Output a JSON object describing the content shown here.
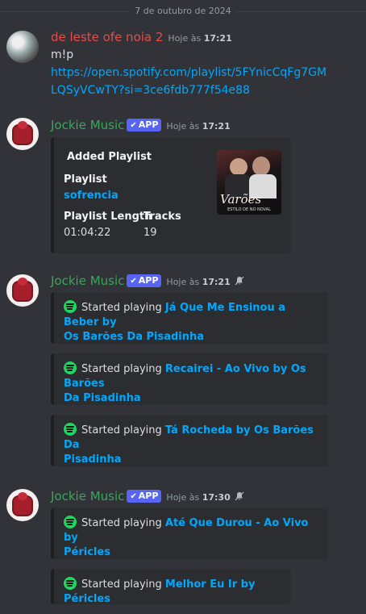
{
  "date_divider": "7 de outubro de 2024",
  "messages": [
    {
      "author": "de leste ofe noia 2",
      "time_prefix": "Hoje às ",
      "time": "17:21",
      "text": "m!p",
      "link_line1": "https://open.spotify.com/playlist/5FYnicCqFg7GM",
      "link_line2": "LQSyVCwTY?si=3ce6fdb777f54e88"
    },
    {
      "author": "Jockie Music",
      "badge": "APP",
      "time_prefix": "Hoje às ",
      "time": "17:21",
      "embed": {
        "title": "Added Playlist",
        "f1_name": "Playlist",
        "f1_value": "sofrencia",
        "f2_name": "Playlist Length",
        "f2_value": "01:04:22",
        "f3_name": "Tracks",
        "f3_value": "19",
        "thumb_script": "Varões",
        "thumb_caption": "ESTILO DE NO NOVAL"
      }
    },
    {
      "author": "Jockie Music",
      "badge": "APP",
      "time_prefix": "Hoje às ",
      "time": "17:21",
      "embeds": [
        {
          "prefix": "Started playing ",
          "song_line1": "Já Que Me Ensinou a Beber by",
          "song_line2": "Os Barões Da Pisadinha"
        },
        {
          "prefix": "Started playing ",
          "song_line1": "Recairei - Ao Vivo by Os Barões",
          "song_line2": "Da Pisadinha"
        },
        {
          "prefix": "Started playing ",
          "song_line1": "Tá Rocheda by Os Barões Da",
          "song_line2": "Pisadinha"
        }
      ]
    },
    {
      "author": "Jockie Music",
      "badge": "APP",
      "time_prefix": "Hoje às ",
      "time": "17:30",
      "embeds": [
        {
          "prefix": "Started playing ",
          "song_line1": "Até Que Durou - Ao Vivo by",
          "song_line2": "Péricles"
        },
        {
          "prefix": "Started playing ",
          "song_line1": "Melhor Eu Ir by Péricles"
        }
      ]
    }
  ],
  "colors": {
    "background": "#313338",
    "embed_bg": "#2b2d31",
    "link": "#00a8fc",
    "user_red": "#e94b4b",
    "bot_green": "#3ba55c",
    "app_badge": "#5865f2",
    "spotify": "#1ed760"
  }
}
